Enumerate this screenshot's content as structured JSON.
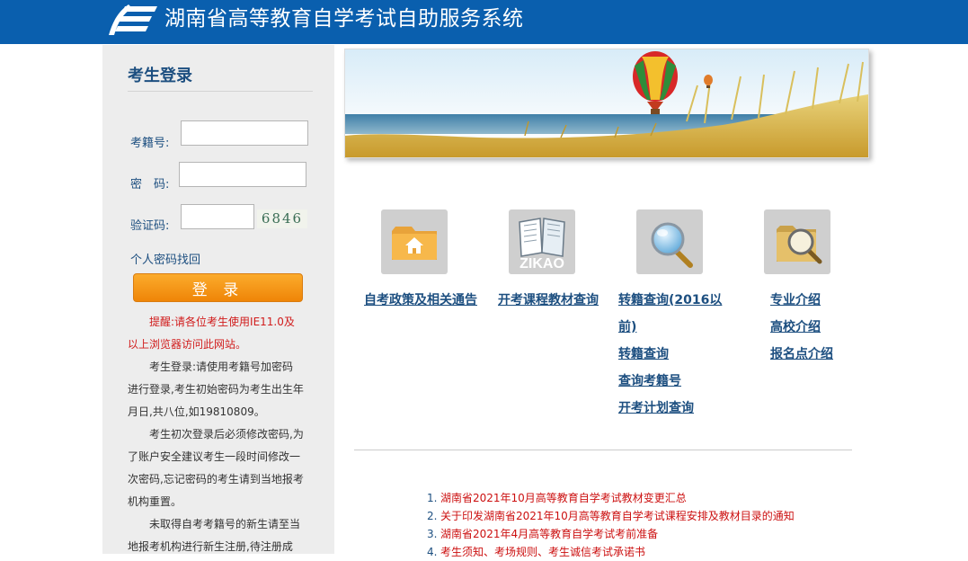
{
  "header": {
    "title": "湖南省高等教育自学考试自助服务系统",
    "logo_icon": "book-logo-icon",
    "background": "#0a5fae"
  },
  "login": {
    "title": "考生登录",
    "id_label": "考籍号:",
    "password_label": "密　码:",
    "captcha_label": "验证码:",
    "captcha_text": "6846",
    "recover_link": "个人密码找回",
    "submit_label": "登 录"
  },
  "notices": [
    "提醒:请各位考生使用IE11.0及以上浏览器访问此网站。",
    "考生登录:请使用考籍号加密码进行登录,考生初始密码为考生出生年月日,共八位,如19810809。",
    "考生初次登录后必须修改密码,为了账户安全建议考生一段时间修改一次密码,忘记密码的考生请到当地报考机构重置。",
    "未取得自考考籍号的新生请至当地报考机构进行新生注册,待注册成"
  ],
  "quick_links": [
    {
      "icon": "folder-home-icon",
      "links": [
        "自考政策及相关通告"
      ]
    },
    {
      "icon": "zikao-book-icon",
      "icon_text": "ZIKAO",
      "links": [
        "开考课程教材查询"
      ]
    },
    {
      "icon": "magnifier-icon",
      "links": [
        "转籍查询(2016以",
        "前)",
        "转籍查询",
        "查询考籍号",
        "开考计划查询"
      ]
    },
    {
      "icon": "folder-search-icon",
      "links": [
        "专业介绍",
        "高校介绍",
        "报名点介绍"
      ]
    }
  ],
  "news": [
    {
      "num": "1.",
      "title": "湖南省2021年10月高等教育自学考试教材变更汇总"
    },
    {
      "num": "2.",
      "title": "关于印发湖南省2021年10月高等教育自学考试课程安排及教材目录的通知"
    },
    {
      "num": "3.",
      "title": "湖南省2021年4月高等教育自学考试考前准备"
    },
    {
      "num": "4.",
      "title": "考生须知、考场规则、考生诚信考试承诺书"
    }
  ],
  "colors": {
    "accent": "#1d4f80",
    "warning": "#d11c1c",
    "news": "#cc1010",
    "button": "#f39514"
  }
}
